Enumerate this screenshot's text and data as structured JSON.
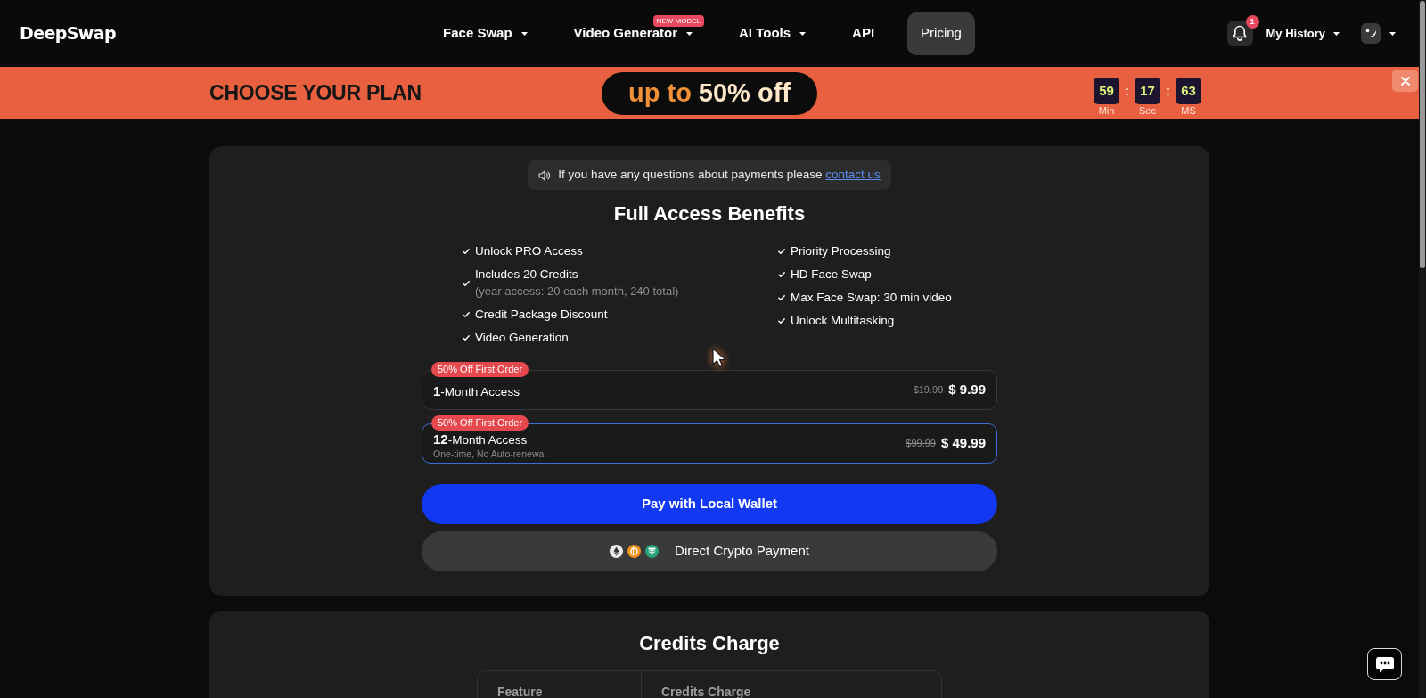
{
  "header": {
    "logo": "DeepSwap",
    "nav": [
      {
        "label": "Face Swap",
        "dropdown": true,
        "selected": false
      },
      {
        "label": "Video Generator",
        "dropdown": true,
        "badge": "NEW MODEL",
        "selected": false
      },
      {
        "label": "AI Tools",
        "dropdown": true,
        "selected": false
      },
      {
        "label": "API",
        "dropdown": false,
        "selected": false
      },
      {
        "label": "Pricing",
        "dropdown": false,
        "selected": true
      }
    ],
    "notification_count": "1",
    "history": "My History"
  },
  "promo_banner": {
    "title": "CHOOSE YOUR PLAN",
    "offer_prefix": "up to",
    "offer": "50% off",
    "countdown": [
      {
        "value": "59",
        "unit": "Min"
      },
      {
        "value": "17",
        "unit": "Sec"
      },
      {
        "value": "63",
        "unit": "MS"
      }
    ],
    "separators": [
      ":",
      ":"
    ]
  },
  "payment_notice": {
    "text": "If you have any questions about payments please",
    "link": "contact us"
  },
  "benefits": {
    "title": "Full Access Benefits",
    "columns": [
      [
        {
          "label": "Unlock PRO Access"
        },
        {
          "label": "Includes 20 Credits",
          "note": "(year access: 20 each month, 240 total)"
        },
        {
          "label": "Credit Package Discount"
        },
        {
          "label": "Video Generation"
        }
      ],
      [
        {
          "label": "Priority Processing"
        },
        {
          "label": "HD Face Swap"
        },
        {
          "label": "Max Face Swap: 30 min video"
        },
        {
          "label": "Unlock Multitasking"
        }
      ]
    ]
  },
  "plans": [
    {
      "badge": "50% Off First Order",
      "name": "**1**-Month Access",
      "old_price": "$19.99",
      "price": "$ 9.99",
      "selected": false
    },
    {
      "badge": "50% Off First Order",
      "name": "**12**-Month Access",
      "note": "One-time, No Auto-renewal",
      "old_price": "$99.99",
      "price": "$ 49.99",
      "selected": true
    }
  ],
  "pay_button": "Pay with Local Wallet",
  "crypto_button": "Direct Crypto Payment",
  "credits_charge": {
    "title": "Credits Charge",
    "columns": [
      "Feature",
      "Credits Charge"
    ]
  }
}
